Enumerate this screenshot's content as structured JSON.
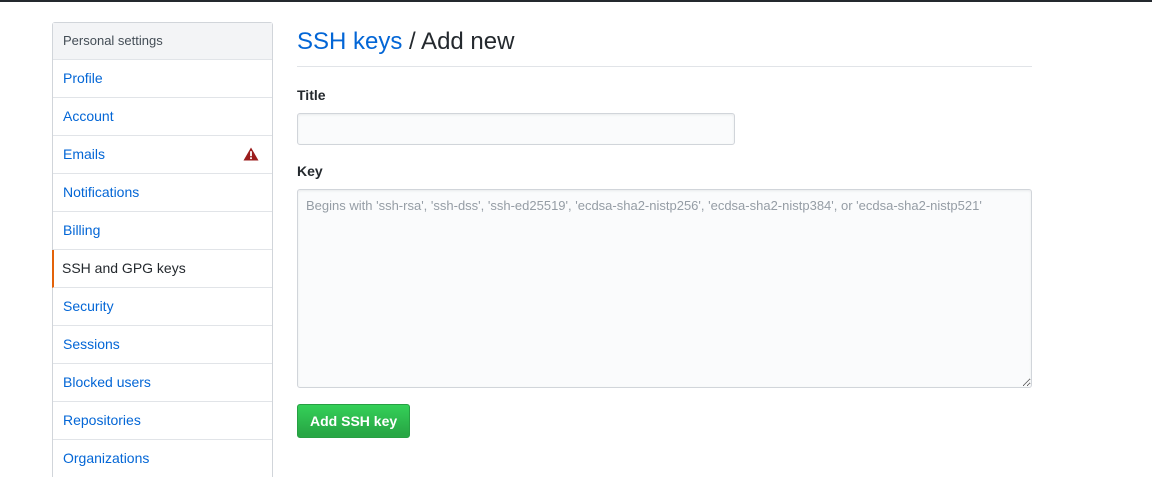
{
  "sidebar": {
    "header": "Personal settings",
    "items": [
      {
        "label": "Profile"
      },
      {
        "label": "Account"
      },
      {
        "label": "Emails",
        "icon": "alert-icon",
        "icon_color": "#cb2431"
      },
      {
        "label": "Notifications"
      },
      {
        "label": "Billing"
      },
      {
        "label": "SSH and GPG keys",
        "selected": true
      },
      {
        "label": "Security"
      },
      {
        "label": "Sessions"
      },
      {
        "label": "Blocked users"
      },
      {
        "label": "Repositories"
      },
      {
        "label": "Organizations"
      }
    ]
  },
  "main": {
    "breadcrumb_link": "SSH keys",
    "breadcrumb_rest": " / Add new",
    "title_label": "Title",
    "title_value": "",
    "key_label": "Key",
    "key_placeholder": "Begins with 'ssh-rsa', 'ssh-dss', 'ssh-ed25519', 'ecdsa-sha2-nistp256', 'ecdsa-sha2-nistp384', or 'ecdsa-sha2-nistp521'",
    "submit_label": "Add SSH key"
  },
  "colors": {
    "link": "#0366d6",
    "selected_border": "#e36209",
    "button": "#28a745",
    "warning": "#cb2431"
  }
}
